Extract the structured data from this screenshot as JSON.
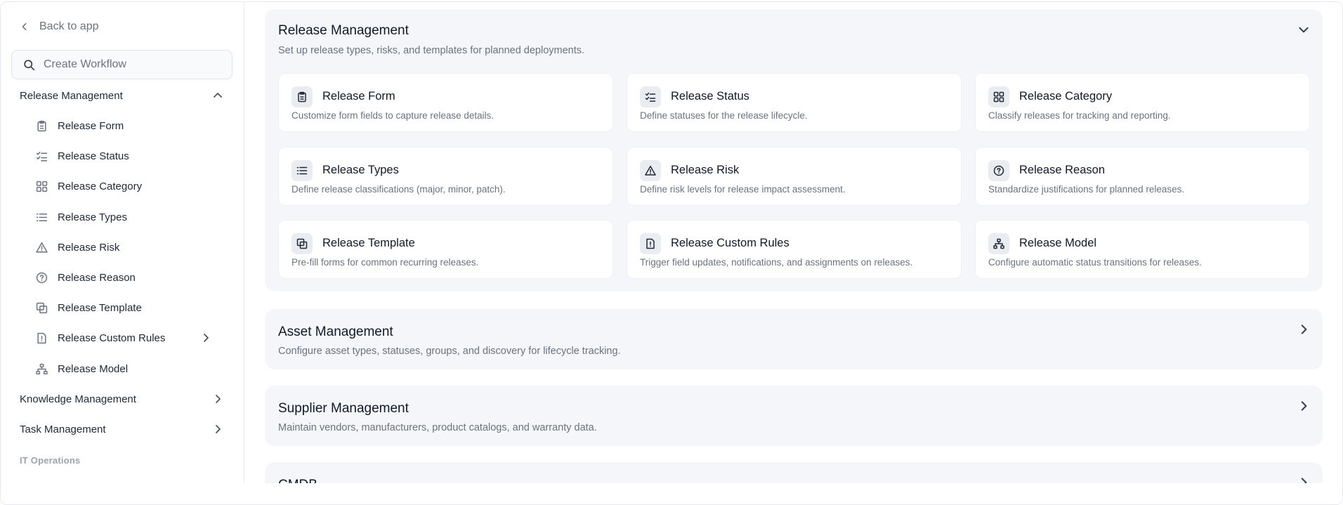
{
  "sidebar": {
    "back_label": "Back to app",
    "search_placeholder": "Create Workflow",
    "groups": {
      "release": "Release Management",
      "knowledge": "Knowledge Management",
      "task": "Task Management"
    },
    "items": [
      {
        "label": "Release Form",
        "icon": "clipboard-icon"
      },
      {
        "label": "Release Status",
        "icon": "checklist-icon"
      },
      {
        "label": "Release Category",
        "icon": "grid-icon"
      },
      {
        "label": "Release Types",
        "icon": "list-icon"
      },
      {
        "label": "Release Risk",
        "icon": "warning-icon"
      },
      {
        "label": "Release Reason",
        "icon": "question-circle-icon"
      },
      {
        "label": "Release Template",
        "icon": "copy-icon"
      },
      {
        "label": "Release Custom Rules",
        "icon": "file-alert-icon"
      },
      {
        "label": "Release Model",
        "icon": "hierarchy-icon"
      }
    ],
    "section_label": "IT Operations"
  },
  "main": {
    "release": {
      "title": "Release Management",
      "description": "Set up release types, risks, and templates for planned deployments.",
      "cards": [
        {
          "title": "Release Form",
          "description": "Customize form fields to capture release details.",
          "icon": "clipboard-icon"
        },
        {
          "title": "Release Status",
          "description": "Define statuses for the release lifecycle.",
          "icon": "checklist-icon"
        },
        {
          "title": "Release Category",
          "description": "Classify releases for tracking and reporting.",
          "icon": "grid-icon"
        },
        {
          "title": "Release Types",
          "description": "Define release classifications (major, minor, patch).",
          "icon": "list-icon"
        },
        {
          "title": "Release Risk",
          "description": "Define risk levels for release impact assessment.",
          "icon": "warning-icon"
        },
        {
          "title": "Release Reason",
          "description": "Standardize justifications for planned releases.",
          "icon": "question-circle-icon"
        },
        {
          "title": "Release Template",
          "description": "Pre-fill forms for common recurring releases.",
          "icon": "copy-icon"
        },
        {
          "title": "Release Custom Rules",
          "description": "Trigger field updates, notifications, and assignments on releases.",
          "icon": "file-alert-icon"
        },
        {
          "title": "Release Model",
          "description": "Configure automatic status transitions for releases.",
          "icon": "hierarchy-icon"
        }
      ]
    },
    "asset": {
      "title": "Asset Management",
      "description": "Configure asset types, statuses, groups, and discovery for lifecycle tracking."
    },
    "supplier": {
      "title": "Supplier Management",
      "description": "Maintain vendors, manufacturers, product catalogs, and warranty data."
    },
    "cmdb": {
      "title": "CMDB"
    }
  },
  "colors": {
    "panel_bg": "#f4f6f9",
    "card_bg": "#ffffff",
    "icon_tile": "#e9ecf0",
    "text_primary": "#111827",
    "text_muted": "#6b7280"
  }
}
